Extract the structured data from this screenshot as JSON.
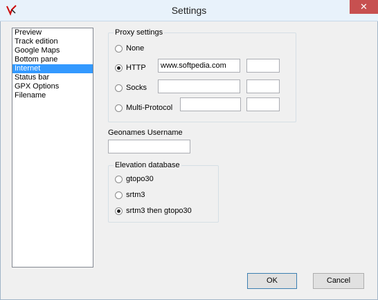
{
  "window": {
    "title": "Settings",
    "close_glyph": "✕"
  },
  "sidebar": {
    "items": [
      {
        "label": "Preview"
      },
      {
        "label": "Track edition"
      },
      {
        "label": "Google Maps"
      },
      {
        "label": "Bottom pane"
      },
      {
        "label": "Internet",
        "selected": true
      },
      {
        "label": "Status bar"
      },
      {
        "label": "GPX Options"
      },
      {
        "label": "Filename"
      }
    ]
  },
  "proxy": {
    "group_label": "Proxy settings",
    "none_label": "None",
    "http_label": "HTTP",
    "http_host": "www.softpedia.com",
    "http_port": "",
    "socks_label": "Socks",
    "socks_host": "",
    "socks_port": "",
    "multi_label": "Multi-Protocol",
    "multi_host": "",
    "multi_port": "",
    "selected": "HTTP"
  },
  "geonames": {
    "label": "Geonames Username",
    "value": ""
  },
  "elevation": {
    "group_label": "Elevation database",
    "gtopo30_label": "gtopo30",
    "srtm3_label": "srtm3",
    "both_label": "srtm3 then gtopo30",
    "selected": "srtm3 then gtopo30"
  },
  "buttons": {
    "ok": "OK",
    "cancel": "Cancel"
  },
  "colors": {
    "selection": "#3399ff",
    "close": "#c75050"
  },
  "icons": {
    "app": "app-logo-icon",
    "close": "close-icon"
  }
}
